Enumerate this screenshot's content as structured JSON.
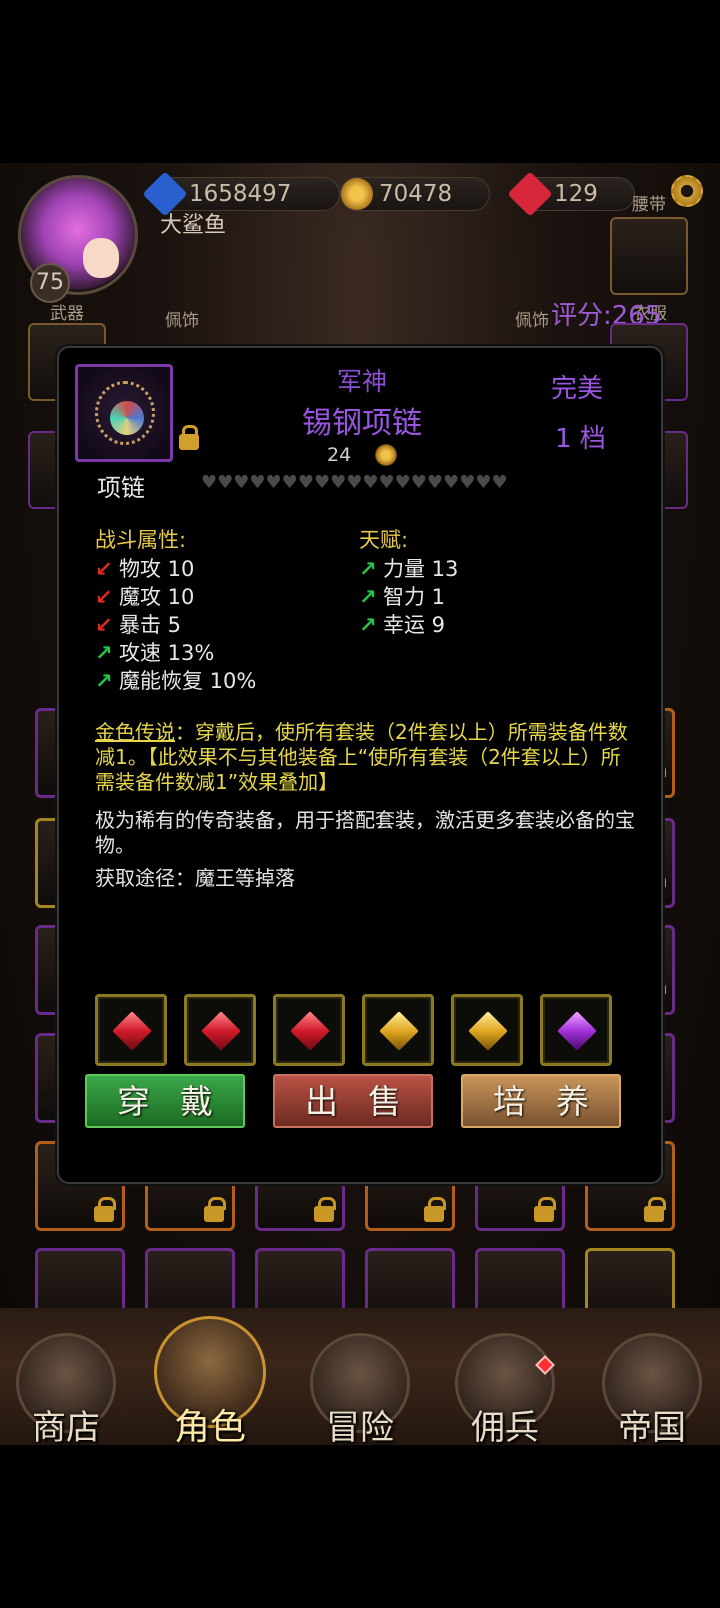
{
  "header": {
    "resources": [
      {
        "name": "blue-gem",
        "value": "1658497",
        "color": "#2a5fd0"
      },
      {
        "name": "gold-coin",
        "value": "70478",
        "color": "#e0a830"
      },
      {
        "name": "red-gem",
        "value": "129",
        "color": "#d6283a"
      }
    ],
    "player_name": "大鲨鱼",
    "level": "75",
    "rating": "评分:265"
  },
  "equipment_labels": {
    "weapon": "武器",
    "accessory_left": "佩饰",
    "accessory_right": "佩饰",
    "belt": "腰带",
    "clothes": "衣服"
  },
  "popup": {
    "subtitle": "军神",
    "title": "锡钢项链",
    "price": "24",
    "quality": "完美",
    "grade": "1 档",
    "type": "项链",
    "hearts": "♥♥♥♥♥♥♥♥♥♥♥♥♥♥♥♥♥♥♥",
    "combat_header": "战斗属性:",
    "talent_header": "天赋:",
    "combat_stats": [
      {
        "label": "物攻 10",
        "trend": "down"
      },
      {
        "label": "魔攻 10",
        "trend": "down"
      },
      {
        "label": "暴击 5",
        "trend": "down"
      },
      {
        "label": "攻速 13%",
        "trend": "up"
      },
      {
        "label": "魔能恢复 10%",
        "trend": "up"
      }
    ],
    "talents": [
      {
        "label": "力量 13",
        "trend": "up"
      },
      {
        "label": "智力 1",
        "trend": "up"
      },
      {
        "label": "幸运 9",
        "trend": "up"
      }
    ],
    "legend_name": "金色传说",
    "legend_text": "：穿戴后，使所有套装（2件套以上）所需装备件数减1。【此效果不与其他装备上“使所有套装（2件套以上）所需装备件数减1”效果叠加】",
    "description": "极为稀有的传奇装备，用于搭配套装，激活更多套装必备的宝物。",
    "source": "获取途径：魔王等掉落",
    "gems": [
      "red",
      "red",
      "red",
      "yellow",
      "yellow",
      "purple"
    ],
    "buttons": {
      "equip": "穿戴",
      "sell": "出售",
      "train": "培养"
    }
  },
  "nav": {
    "items": [
      {
        "label": "商店",
        "active": false
      },
      {
        "label": "角色",
        "active": true
      },
      {
        "label": "冒险",
        "active": false
      },
      {
        "label": "佣兵",
        "active": false
      },
      {
        "label": "帝国",
        "active": false
      }
    ]
  }
}
